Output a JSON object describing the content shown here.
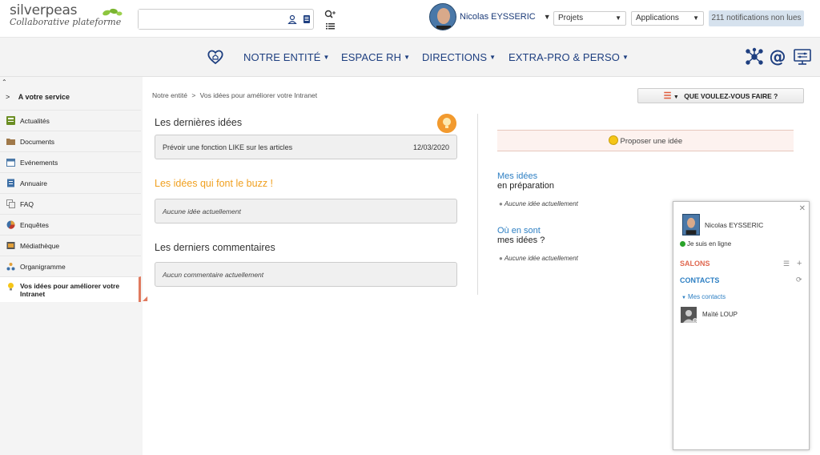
{
  "brand": {
    "name": "silverpeas",
    "tagline": "Collaborative plateforme"
  },
  "search": {
    "value": "",
    "placeholder": ""
  },
  "user": {
    "name": "Nicolas EYSSERIC"
  },
  "header": {
    "spaces_select": "Projets",
    "apps_select": "Applications",
    "notifications": "211 notifications non lues"
  },
  "nav": {
    "items": [
      {
        "label": "NOTRE ENTITÉ"
      },
      {
        "label": "ESPACE RH"
      },
      {
        "label": "DIRECTIONS"
      },
      {
        "label": "EXTRA-PRO & PERSO"
      }
    ]
  },
  "sidebar": {
    "header": "A votre service",
    "items": [
      {
        "label": "Actualités",
        "icon": "news-icon"
      },
      {
        "label": "Documents",
        "icon": "folder-icon"
      },
      {
        "label": "Evénements",
        "icon": "calendar-icon"
      },
      {
        "label": "Annuaire",
        "icon": "directory-icon"
      },
      {
        "label": "FAQ",
        "icon": "faq-icon"
      },
      {
        "label": "Enquêtes",
        "icon": "survey-icon"
      },
      {
        "label": "Médiathèque",
        "icon": "media-icon"
      },
      {
        "label": "Organigramme",
        "icon": "org-chart-icon"
      },
      {
        "label": "Vos idées pour améliorer votre Intranet",
        "icon": "lightbulb-icon",
        "active": true
      }
    ]
  },
  "breadcrumb": {
    "root": "Notre entité",
    "sep": ">",
    "current": "Vos idées pour améliorer votre Intranet"
  },
  "action_button": "QUE VOULEZ-VOUS FAIRE ?",
  "main": {
    "latest_title": "Les dernières idées",
    "latest_item": {
      "title": "Prévoir une fonction LIKE sur les articles",
      "date": "12/03/2020"
    },
    "buzz_title": "Les idées qui font le buzz !",
    "buzz_empty": "Aucune idée actuellement",
    "comments_title": "Les derniers commentaires",
    "comments_empty": "Aucun commentaire actuellement"
  },
  "right": {
    "propose": "Proposer une idée",
    "prep_line1": "Mes idées",
    "prep_line2": "en préparation",
    "prep_empty": "Aucune idée actuellement",
    "status_line1": "Où en sont",
    "status_line2": "mes idées ?",
    "status_empty": "Aucune idée actuellement"
  },
  "chat": {
    "name": "Nicolas EYSSERIC",
    "status": "Je suis en ligne",
    "salons": "SALONS",
    "contacts": "CONTACTS",
    "my_contacts": "Mes contacts",
    "contact": "Maïté LOUP"
  }
}
